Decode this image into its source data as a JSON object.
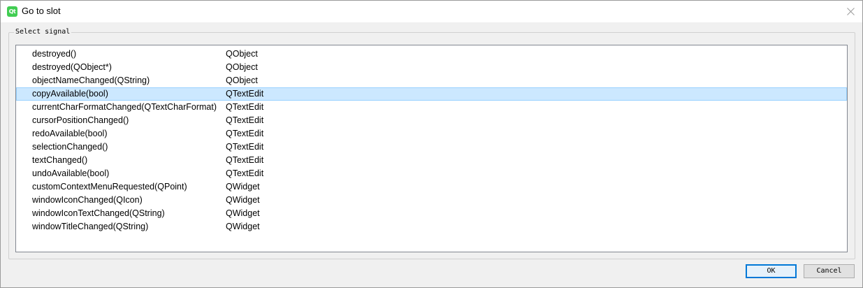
{
  "window": {
    "title": "Go to slot",
    "app_icon_text": "Qt"
  },
  "group": {
    "legend": "Select signal"
  },
  "signals": [
    {
      "signal": "destroyed()",
      "class": "QObject"
    },
    {
      "signal": "destroyed(QObject*)",
      "class": "QObject"
    },
    {
      "signal": "objectNameChanged(QString)",
      "class": "QObject"
    },
    {
      "signal": "copyAvailable(bool)",
      "class": "QTextEdit",
      "selected": true
    },
    {
      "signal": "currentCharFormatChanged(QTextCharFormat)",
      "class": "QTextEdit"
    },
    {
      "signal": "cursorPositionChanged()",
      "class": "QTextEdit"
    },
    {
      "signal": "redoAvailable(bool)",
      "class": "QTextEdit"
    },
    {
      "signal": "selectionChanged()",
      "class": "QTextEdit"
    },
    {
      "signal": "textChanged()",
      "class": "QTextEdit"
    },
    {
      "signal": "undoAvailable(bool)",
      "class": "QTextEdit"
    },
    {
      "signal": "customContextMenuRequested(QPoint)",
      "class": "QWidget"
    },
    {
      "signal": "windowIconChanged(QIcon)",
      "class": "QWidget"
    },
    {
      "signal": "windowIconTextChanged(QString)",
      "class": "QWidget"
    },
    {
      "signal": "windowTitleChanged(QString)",
      "class": "QWidget"
    }
  ],
  "buttons": {
    "ok_label": "OK",
    "cancel_label": "Cancel"
  },
  "colors": {
    "selection_background": "#cce8ff",
    "selection_border": "#99d1ff",
    "default_button_border": "#0078d7",
    "qt_green": "#41cd52"
  },
  "icons": {
    "app": "qt-logo-icon",
    "close": "close-icon"
  }
}
